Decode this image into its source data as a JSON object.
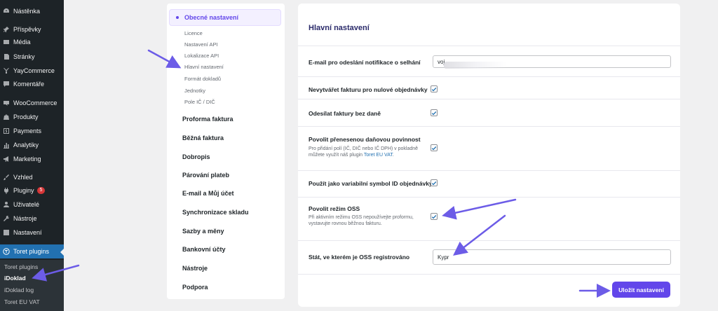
{
  "wp_menu": {
    "items": [
      {
        "label": "Nástěnka",
        "icon": "dashboard-icon"
      },
      {
        "label": "Příspěvky",
        "icon": "pin-icon"
      },
      {
        "label": "Média",
        "icon": "media-icon"
      },
      {
        "label": "Stránky",
        "icon": "page-icon"
      },
      {
        "label": "YayCommerce",
        "icon": "yaycommerce-icon"
      },
      {
        "label": "Komentáře",
        "icon": "comment-icon"
      },
      {
        "label": "WooCommerce",
        "icon": "woocommerce-icon"
      },
      {
        "label": "Produkty",
        "icon": "products-icon"
      },
      {
        "label": "Payments",
        "icon": "payments-icon"
      },
      {
        "label": "Analytiky",
        "icon": "analytics-icon"
      },
      {
        "label": "Marketing",
        "icon": "megaphone-icon"
      },
      {
        "label": "Vzhled",
        "icon": "brush-icon"
      },
      {
        "label": "Pluginy",
        "icon": "plugin-icon",
        "badge": "5"
      },
      {
        "label": "Uživatelé",
        "icon": "users-icon"
      },
      {
        "label": "Nástroje",
        "icon": "wrench-icon"
      },
      {
        "label": "Nastavení",
        "icon": "settings-icon"
      },
      {
        "label": "Toret plugins",
        "icon": "toret-icon"
      }
    ],
    "submenu": [
      "Toret plugins",
      "iDoklad",
      "iDoklad log",
      "Toret EU VAT"
    ]
  },
  "settings_nav": {
    "active": "Obecné nastavení",
    "subitems": [
      "Licence",
      "Nastavení API",
      "Lokalizace API",
      "Hlavní nastavení",
      "Formát dokladů",
      "Jednotky",
      "Pole IČ / DIČ"
    ],
    "sections": [
      "Proforma faktura",
      "Běžná faktura",
      "Dobropis",
      "Párování plateb",
      "E-mail a Můj účet",
      "Synchronizace skladu",
      "Sazby a měny",
      "Bankovní účty",
      "Nástroje",
      "Podpora"
    ]
  },
  "main": {
    "title": "Hlavní nastavení",
    "email_label": "E-mail pro odeslání notifikace o selhání",
    "email_value": "voj",
    "no_zero_invoice_label": "Nevytvářet fakturu pro nulové objednávky",
    "no_tax_invoice_label": "Odesílat faktury bez daně",
    "reverse_charge_label": "Povolit přenesenou daňovou povinnost",
    "reverse_charge_desc": "Pro přidání polí (IČ, DIČ nebo IČ DPH) v pokladně můžete využít náš plugin",
    "reverse_charge_link": "Toret EU VAT",
    "variable_symbol_label": "Použít jako variabilní symbol ID objednávky",
    "oss_label": "Povolit režim OSS",
    "oss_desc": "Při aktivním režimu OSS nepoužívejte proformu, vystavujte rovnou běžnou fakturu.",
    "oss_country_label": "Stát, ve kterém je OSS registrováno",
    "oss_country_value": "Kypr",
    "save_label": "Uložit nastavení"
  },
  "colors": {
    "accent": "#6246ea",
    "wp_sidebar": "#1d2327",
    "wp_active": "#2271b1"
  }
}
